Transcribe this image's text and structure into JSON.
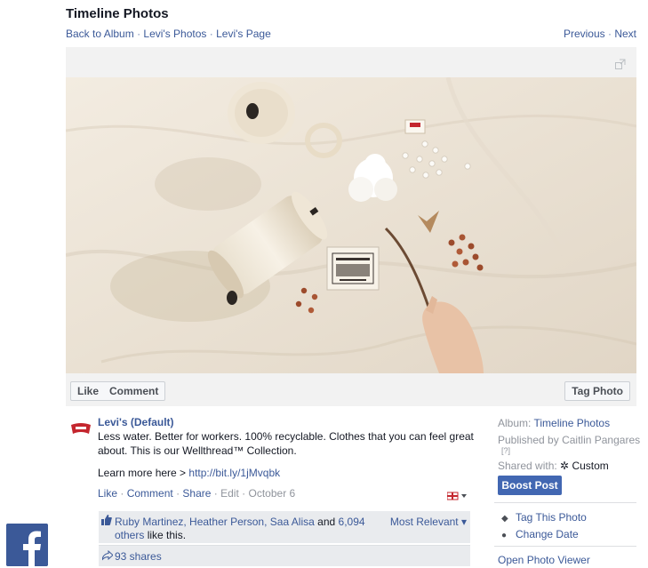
{
  "header": {
    "title": "Timeline Photos",
    "breadcrumbs": [
      "Back to Album",
      "Levi's Photos",
      "Levi's Page"
    ],
    "breadcrumb_separator": "·",
    "prev_label": "Previous",
    "next_label": "Next"
  },
  "action_bar": {
    "like_label": "Like",
    "comment_label": "Comment",
    "tag_photo_label": "Tag Photo"
  },
  "post": {
    "author": "Levi's (Default)",
    "text": "Less water. Better for workers. 100% recyclable. Clothes that you can feel great about. This is our Wellthread™ Collection.",
    "learn_prefix": "Learn more here > ",
    "link": "http://bit.ly/1jMvqbk",
    "actions": {
      "like": "Like",
      "comment": "Comment",
      "share": "Share",
      "edit": "Edit",
      "date": "October 6"
    }
  },
  "social": {
    "likers": [
      "Ruby Martinez",
      "Heather Person",
      "Saa Alisa"
    ],
    "and_label": "and",
    "others_count": "6,094 others",
    "like_suffix": "like this.",
    "sort_label": "Most Relevant",
    "shares": "93 shares"
  },
  "sidebar": {
    "album_label": "Album:",
    "album_name": "Timeline Photos",
    "published_label": "Published by",
    "publisher": "Caitlin Pangares",
    "help_marker": "[?]",
    "shared_label": "Shared with:",
    "shared_value": "Custom",
    "boost_label": "Boost Post",
    "tag_this_photo": "Tag This Photo",
    "change_date": "Change Date",
    "open_photo_viewer": "Open Photo Viewer"
  },
  "colors": {
    "brand_blue": "#3b5998",
    "boost_blue": "#4267b2",
    "panel_gray": "#e9ebee"
  },
  "icons": [
    "expand-icon",
    "levis-avatar-icon",
    "flag-audience-icon",
    "thumbs-up-icon",
    "share-arrow-icon",
    "tag-icon",
    "clock-icon",
    "gear-icon",
    "facebook-logo-icon"
  ]
}
